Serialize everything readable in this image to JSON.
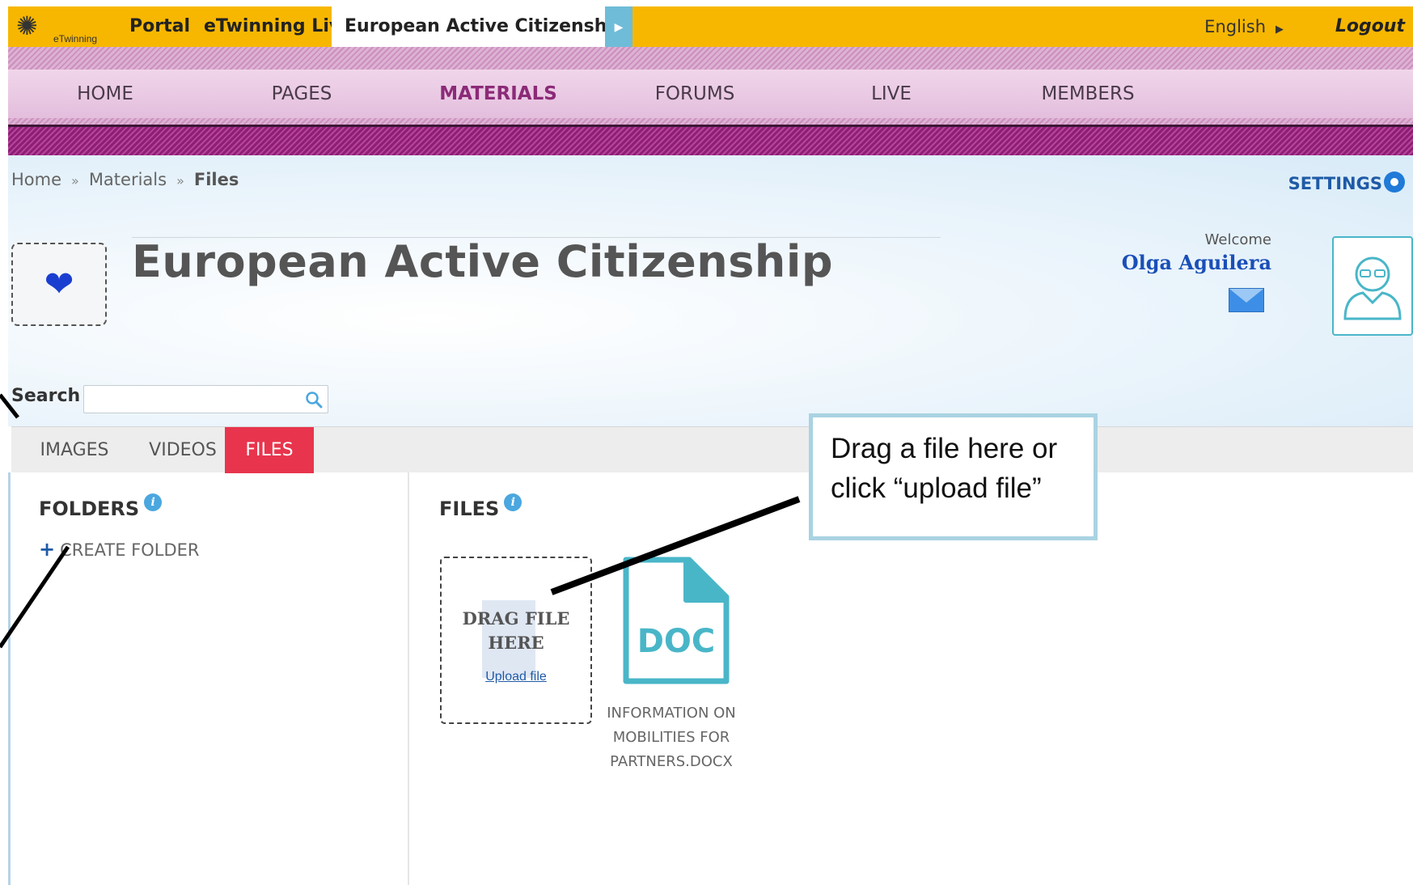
{
  "topbar": {
    "logo_text": "eTwinning",
    "portal": "Portal",
    "live": "eTwinning Live",
    "active_tab": "European Active Citizensh...",
    "language": "English",
    "logout": "Logout",
    "color": "#f7b700"
  },
  "nav": {
    "items": [
      {
        "label": "HOME"
      },
      {
        "label": "PAGES"
      },
      {
        "label": "MATERIALS",
        "active": true
      },
      {
        "label": "FORUMS"
      },
      {
        "label": "LIVE"
      },
      {
        "label": "MEMBERS"
      }
    ]
  },
  "breadcrumb": {
    "home": "Home",
    "materials": "Materials",
    "current": "Files"
  },
  "settings_label": "SETTINGS",
  "project": {
    "title": "European Active Citizenship",
    "icon": "heart-icon"
  },
  "user": {
    "welcome": "Welcome",
    "name": "Olga Aguilera"
  },
  "search": {
    "label": "Search",
    "value": "",
    "placeholder": ""
  },
  "tabs": {
    "images": "IMAGES",
    "videos": "VIDEOS",
    "files": "FILES",
    "active_color": "#e8354d"
  },
  "folders": {
    "title": "FOLDERS",
    "create": "CREATE FOLDER"
  },
  "files": {
    "title": "FILES",
    "dropzone_line1": "DRAG FILE",
    "dropzone_line2": "HERE",
    "upload_link": "Upload file",
    "items": [
      {
        "type": "DOC",
        "name_line1": "INFORMATION ON",
        "name_line2": "MOBILITIES FOR",
        "name_line3": "PARTNERS.DOCX"
      }
    ]
  },
  "callout": {
    "line1": "Drag a file here or",
    "line2": "click “upload file”"
  }
}
